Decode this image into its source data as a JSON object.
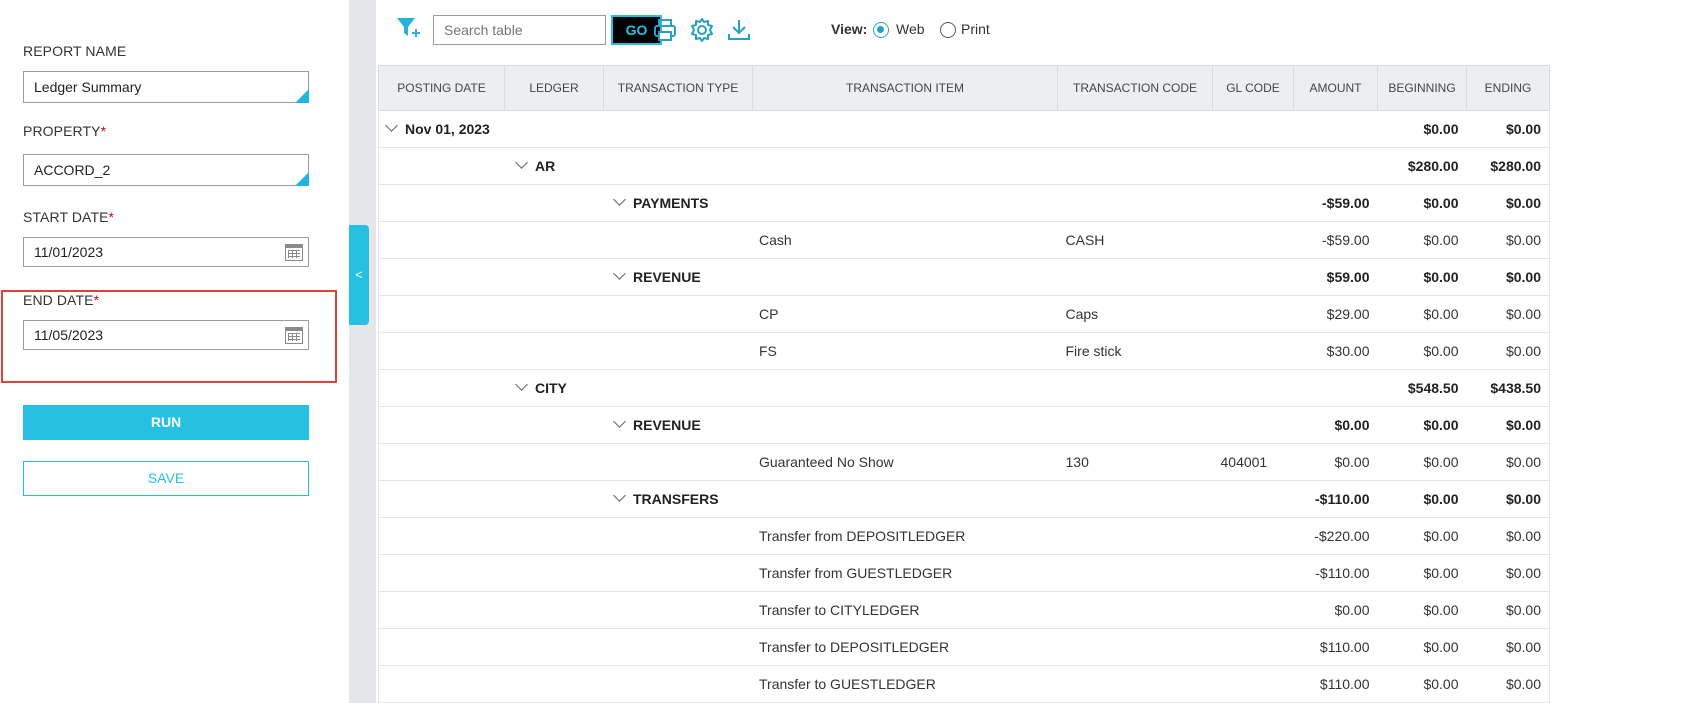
{
  "form": {
    "report_name_label": "REPORT NAME",
    "report_name_value": "Ledger Summary",
    "property_label": "PROPERTY",
    "property_value": "ACCORD_2",
    "start_date_label": "START DATE",
    "start_date_value": "11/01/2023",
    "end_date_label": "END DATE",
    "end_date_value": "11/05/2023",
    "required_marker": "*",
    "run_label": "RUN",
    "save_label": "SAVE",
    "collapse_glyph": "<"
  },
  "toolbar": {
    "search_placeholder": "Search table",
    "go_label": "GO",
    "view_label": "View:",
    "view_options": [
      "Web",
      "Print"
    ],
    "selected_view": "Web",
    "icons": [
      "filter-add-icon",
      "print-icon",
      "gear-icon",
      "download-icon"
    ]
  },
  "table": {
    "columns": [
      "POSTING DATE",
      "LEDGER",
      "TRANSACTION TYPE",
      "TRANSACTION ITEM",
      "TRANSACTION CODE",
      "GL CODE",
      "AMOUNT",
      "BEGINNING",
      "ENDING"
    ],
    "rows": [
      {
        "kind": "group",
        "level": 0,
        "label": "Nov 01, 2023",
        "code": "",
        "gl": "",
        "amount": "",
        "beginning": "$0.00",
        "ending": "$0.00"
      },
      {
        "kind": "group",
        "level": 1,
        "label": "AR",
        "code": "",
        "gl": "",
        "amount": "",
        "beginning": "$280.00",
        "ending": "$280.00"
      },
      {
        "kind": "group",
        "level": 2,
        "label": "PAYMENTS",
        "code": "",
        "gl": "",
        "amount": "-$59.00",
        "beginning": "$0.00",
        "ending": "$0.00"
      },
      {
        "kind": "item",
        "level": 3,
        "label": "Cash",
        "code": "CASH",
        "gl": "",
        "amount": "-$59.00",
        "beginning": "$0.00",
        "ending": "$0.00"
      },
      {
        "kind": "group",
        "level": 2,
        "label": "REVENUE",
        "code": "",
        "gl": "",
        "amount": "$59.00",
        "beginning": "$0.00",
        "ending": "$0.00"
      },
      {
        "kind": "item",
        "level": 3,
        "label": "CP",
        "code": "Caps",
        "gl": "",
        "amount": "$29.00",
        "beginning": "$0.00",
        "ending": "$0.00"
      },
      {
        "kind": "item",
        "level": 3,
        "label": "FS",
        "code": "Fire stick",
        "gl": "",
        "amount": "$30.00",
        "beginning": "$0.00",
        "ending": "$0.00"
      },
      {
        "kind": "group",
        "level": 1,
        "label": "CITY",
        "code": "",
        "gl": "",
        "amount": "",
        "beginning": "$548.50",
        "ending": "$438.50"
      },
      {
        "kind": "group",
        "level": 2,
        "label": "REVENUE",
        "code": "",
        "gl": "",
        "amount": "$0.00",
        "beginning": "$0.00",
        "ending": "$0.00"
      },
      {
        "kind": "item",
        "level": 3,
        "label": "Guaranteed No Show",
        "code": "130",
        "gl": "404001",
        "amount": "$0.00",
        "beginning": "$0.00",
        "ending": "$0.00"
      },
      {
        "kind": "group",
        "level": 2,
        "label": "TRANSFERS",
        "code": "",
        "gl": "",
        "amount": "-$110.00",
        "beginning": "$0.00",
        "ending": "$0.00"
      },
      {
        "kind": "item",
        "level": 3,
        "label": "Transfer from DEPOSITLEDGER",
        "code": "",
        "gl": "",
        "amount": "-$220.00",
        "beginning": "$0.00",
        "ending": "$0.00"
      },
      {
        "kind": "item",
        "level": 3,
        "label": "Transfer from GUESTLEDGER",
        "code": "",
        "gl": "",
        "amount": "-$110.00",
        "beginning": "$0.00",
        "ending": "$0.00"
      },
      {
        "kind": "item",
        "level": 3,
        "label": "Transfer to CITYLEDGER",
        "code": "",
        "gl": "",
        "amount": "$0.00",
        "beginning": "$0.00",
        "ending": "$0.00"
      },
      {
        "kind": "item",
        "level": 3,
        "label": "Transfer to DEPOSITLEDGER",
        "code": "",
        "gl": "",
        "amount": "$110.00",
        "beginning": "$0.00",
        "ending": "$0.00"
      },
      {
        "kind": "item",
        "level": 3,
        "label": "Transfer to GUESTLEDGER",
        "code": "",
        "gl": "",
        "amount": "$110.00",
        "beginning": "$0.00",
        "ending": "$0.00"
      }
    ]
  },
  "colors": {
    "accent": "#27c0e3",
    "highlight_border": "#e0413b",
    "header_bg": "#eceef1",
    "divider_bg": "#e4e6ea"
  }
}
